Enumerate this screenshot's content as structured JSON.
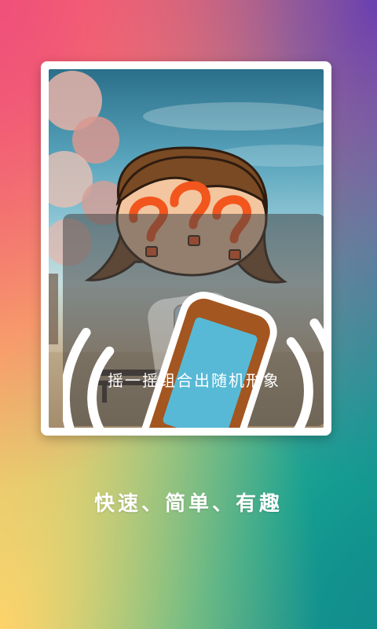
{
  "preview": {
    "hint": "摇一摇组合出随机形象",
    "illustration_icon": "cartoon-girl-question-marks",
    "shake_icon": "shaking-phone-icon"
  },
  "footer": {
    "tagline": "快速、简单、有趣"
  },
  "colors": {
    "accent": "#f2561d",
    "phone_screen": "#57b9d6",
    "phone_body": "#a3561f"
  }
}
